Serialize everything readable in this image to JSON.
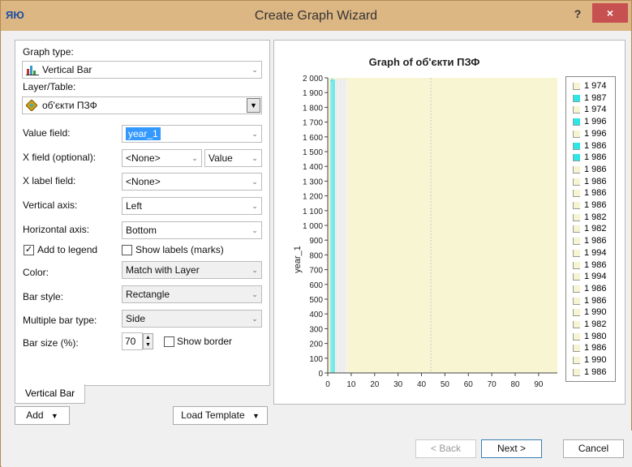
{
  "window": {
    "title": "Create Graph Wizard",
    "help": "?",
    "close": "×"
  },
  "form": {
    "graph_type_label": "Graph type:",
    "graph_type_value": "Vertical Bar",
    "layer_label": "Layer/Table:",
    "layer_value": "об'єкти ПЗФ",
    "value_field_label": "Value field:",
    "value_field_value": "year_1",
    "x_field_label": "X field (optional):",
    "x_field_value": "<None>",
    "x_field_mode": "Value",
    "x_label_field_label": "X label field:",
    "x_label_field_value": "<None>",
    "vertical_axis_label": "Vertical axis:",
    "vertical_axis_value": "Left",
    "horizontal_axis_label": "Horizontal axis:",
    "horizontal_axis_value": "Bottom",
    "add_to_legend_label": "Add to legend",
    "add_to_legend_checked": true,
    "show_labels_label": "Show labels (marks)",
    "show_labels_checked": false,
    "color_label": "Color:",
    "color_value": "Match with Layer",
    "bar_style_label": "Bar style:",
    "bar_style_value": "Rectangle",
    "multiple_bar_label": "Multiple bar type:",
    "multiple_bar_value": "Side",
    "bar_size_label": "Bar size (%):",
    "bar_size_value": "70",
    "show_border_label": "Show border",
    "show_border_checked": false
  },
  "tabs": {
    "active": "Vertical Bar"
  },
  "buttons": {
    "add": "Add",
    "load_template": "Load Template",
    "back": "< Back",
    "next": "Next >",
    "cancel": "Cancel"
  },
  "chart_data": {
    "type": "bar",
    "title": "Graph of об'єкти ПЗФ",
    "ylabel": "year_1",
    "xlabel": "",
    "ylim": [
      0,
      2000
    ],
    "xlim": [
      0,
      98
    ],
    "yticks": [
      "0",
      "100",
      "200",
      "300",
      "400",
      "500",
      "600",
      "700",
      "800",
      "900",
      "1 000",
      "1 100",
      "1 200",
      "1 300",
      "1 400",
      "1 500",
      "1 600",
      "1 700",
      "1 800",
      "1 900",
      "2 000"
    ],
    "xticks": [
      "0",
      "10",
      "20",
      "30",
      "40",
      "50",
      "60",
      "70",
      "80",
      "90"
    ],
    "plot_background": "#f8f5d2",
    "highlight_color": "#2ee6e6",
    "bars": [
      {
        "x": 1,
        "value": 1974,
        "highlight": false
      },
      {
        "x": 2,
        "value": 1987,
        "highlight": true
      },
      {
        "x": 3,
        "value": 1974,
        "highlight": false
      },
      {
        "x": 4,
        "value": 1996,
        "highlight": true
      },
      {
        "x": 5,
        "value": 1996,
        "highlight": false
      },
      {
        "x": 6,
        "value": 1986,
        "highlight": true
      },
      {
        "x": 7,
        "value": 1986,
        "highlight": true
      },
      {
        "x": 8,
        "value": 1986,
        "highlight": false
      },
      {
        "x": 9,
        "value": 1986,
        "highlight": false
      },
      {
        "x": 10,
        "value": 1986,
        "highlight": false
      },
      {
        "x": 11,
        "value": 1986,
        "highlight": false
      },
      {
        "x": 12,
        "value": 1982,
        "highlight": false
      },
      {
        "x": 13,
        "value": 1982,
        "highlight": false
      },
      {
        "x": 14,
        "value": 1986,
        "highlight": false
      },
      {
        "x": 15,
        "value": 1994,
        "highlight": false
      },
      {
        "x": 16,
        "value": 1986,
        "highlight": false
      },
      {
        "x": 17,
        "value": 1994,
        "highlight": false
      },
      {
        "x": 18,
        "value": 1986,
        "highlight": false
      },
      {
        "x": 19,
        "value": 1986,
        "highlight": false
      },
      {
        "x": 20,
        "value": 1990,
        "highlight": false
      },
      {
        "x": 21,
        "value": 1982,
        "highlight": false
      },
      {
        "x": 22,
        "value": 1980,
        "highlight": false
      },
      {
        "x": 23,
        "value": 1986,
        "highlight": false
      },
      {
        "x": 24,
        "value": 1990,
        "highlight": false
      },
      {
        "x": 25,
        "value": 1986,
        "highlight": false
      }
    ],
    "legend": [
      "1 974",
      "1 987",
      "1 974",
      "1 996",
      "1 996",
      "1 986",
      "1 986",
      "1 986",
      "1 986",
      "1 986",
      "1 986",
      "1 982",
      "1 982",
      "1 986",
      "1 994",
      "1 986",
      "1 994",
      "1 986",
      "1 986",
      "1 990",
      "1 982",
      "1 980",
      "1 986",
      "1 990",
      "1 986"
    ],
    "legend_highlight": [
      false,
      true,
      false,
      true,
      false,
      true,
      true,
      false,
      false,
      false,
      false,
      false,
      false,
      false,
      false,
      false,
      false,
      false,
      false,
      false,
      false,
      false,
      false,
      false,
      false
    ]
  }
}
